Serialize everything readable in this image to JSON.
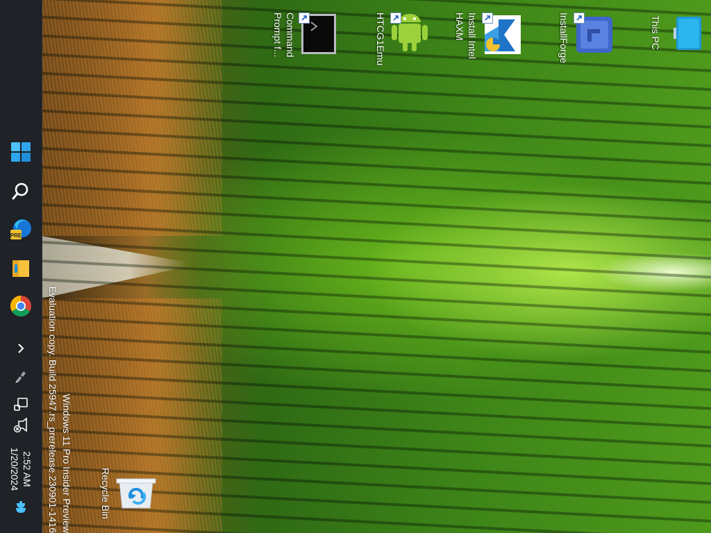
{
  "desktop": {
    "icons": [
      {
        "name": "This PC",
        "kind": "computer-icon"
      },
      {
        "name": "InstallForge",
        "kind": "installforge-icon",
        "shortcut": true
      },
      {
        "name": "Install Intel HAXM",
        "line1": "Install Intel",
        "line2": "HAXM",
        "kind": "installer-icon",
        "shortcut": true
      },
      {
        "name": "HTCG1Emu",
        "kind": "android-icon",
        "shortcut": true
      },
      {
        "name": "Command Prompt f...",
        "line1": "Command",
        "line2": "Prompt f...",
        "kind": "cmd-icon",
        "shortcut": true
      },
      {
        "name": "Recycle Bin",
        "kind": "recycle-bin-icon"
      }
    ]
  },
  "watermark": {
    "line1": "Windows 11 Pro Insider Preview",
    "line2": "Evaluation copy. Build 25947.rs_prerelease.230901-1416"
  },
  "taskbar": {
    "orientation": "left (rotated 90°)",
    "pinned": [
      {
        "name": "Start",
        "icon": "windows-start-icon"
      },
      {
        "name": "Search",
        "icon": "search-icon"
      },
      {
        "name": "Microsoft Edge Canary",
        "icon": "edge-pre-icon",
        "badge": "PRE"
      },
      {
        "name": "File Explorer",
        "icon": "folder-icon"
      },
      {
        "name": "Google Chrome",
        "icon": "chrome-icon"
      }
    ],
    "tray": {
      "overflow_icon": "chevron-icon",
      "icons": [
        "pen-icon",
        "network-icon",
        "volume-muted-icon"
      ],
      "time": "2:52 AM",
      "date": "1/20/2024",
      "notification_icon": "notification-bell-icon"
    }
  },
  "colors": {
    "taskbar_bg": "#1f2226",
    "start_blue": "#4cc2ff",
    "wallpaper_green": "#4e9a1c"
  }
}
